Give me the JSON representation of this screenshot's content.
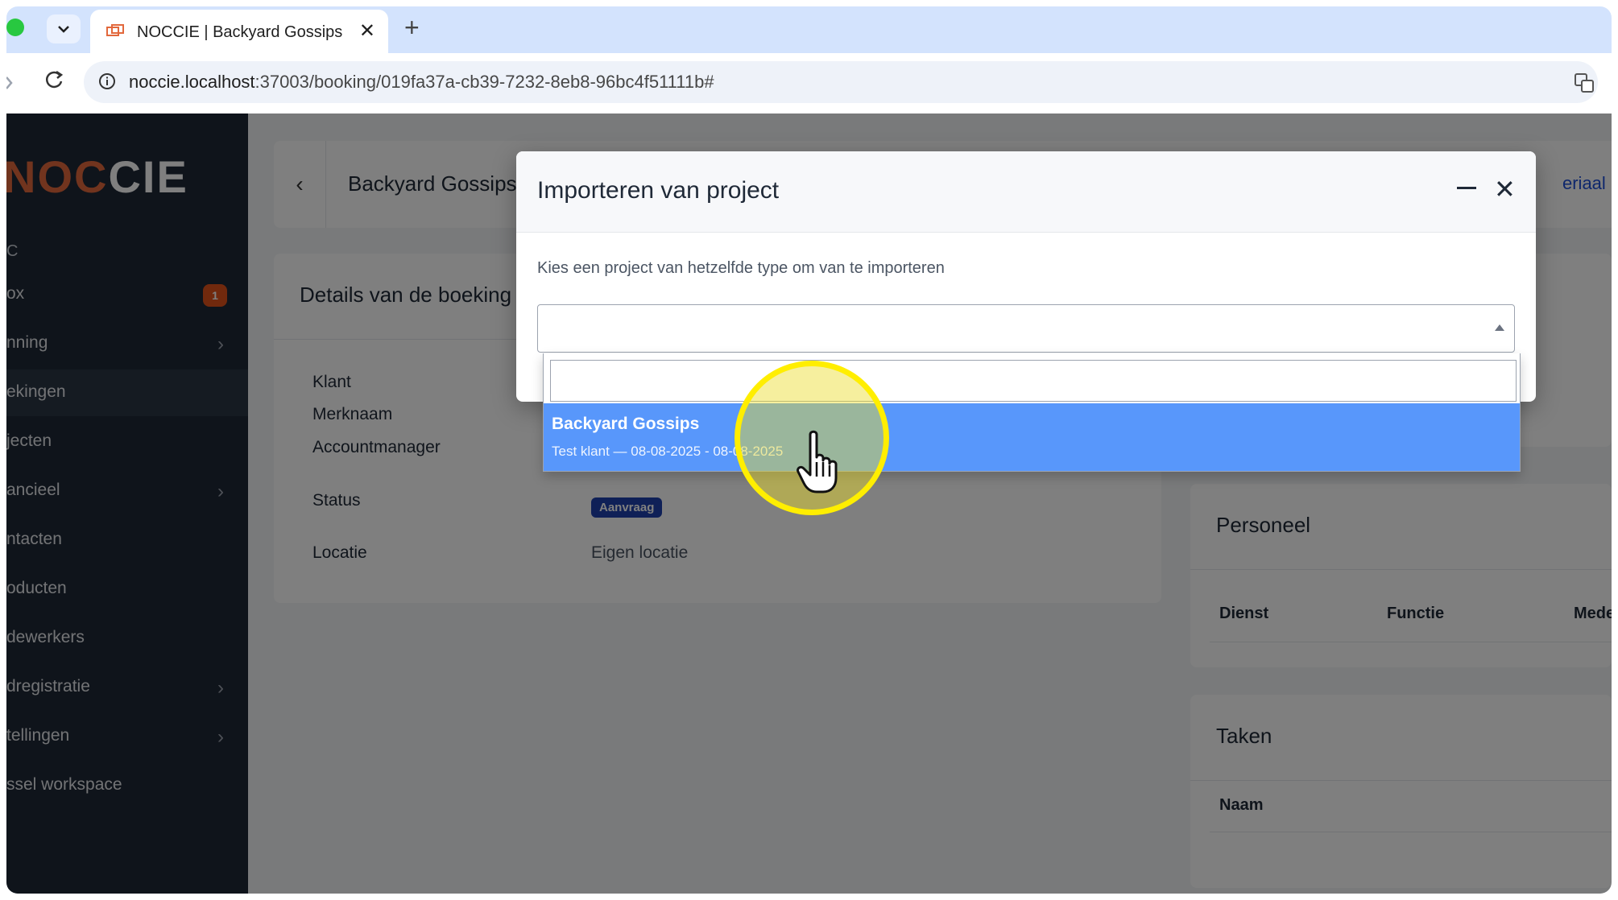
{
  "browser": {
    "tab_title": "NOCCIE | Backyard Gossips",
    "close_glyph": "✕",
    "new_tab_glyph": "+",
    "url_host": "noccie.localhost",
    "url_rest": ":37003/booking/019fa37a-cb39-7232-8eb8-96bc4f51111b#"
  },
  "sidebar": {
    "logo_noc": "NOC",
    "logo_cie": "CIE",
    "section": "C",
    "items": [
      {
        "label": "ox",
        "badge": "1"
      },
      {
        "label": "nning",
        "chevron": "›"
      },
      {
        "label": "ekingen"
      },
      {
        "label": "jecten"
      },
      {
        "label": "ancieel",
        "chevron": "›"
      },
      {
        "label": "ntacten"
      },
      {
        "label": "oducten"
      },
      {
        "label": "dewerkers"
      },
      {
        "label": "dregistratie",
        "chevron": "›"
      },
      {
        "label": "tellingen",
        "chevron": "›"
      },
      {
        "label": "ssel workspace"
      }
    ]
  },
  "header": {
    "back_glyph": "‹",
    "title": "Backyard Gossips",
    "link": "eriaal"
  },
  "details": {
    "title": "Details van de boeking",
    "labels": {
      "klant": "Klant",
      "merknaam": "Merknaam",
      "accountmanager": "Accountmanager",
      "status": "Status",
      "locatie": "Locatie"
    },
    "status_value": "Aanvraag",
    "locatie_value": "Eigen locatie"
  },
  "personeel": {
    "title": "Personeel",
    "columns": [
      "Dienst",
      "Functie",
      "Mede"
    ]
  },
  "taken": {
    "title": "Taken",
    "columns": [
      "Naam"
    ]
  },
  "modal": {
    "title": "Importeren van project",
    "minimize_label": "—",
    "close_glyph": "✕",
    "hint": "Kies een project van hetzelfde type om van te importeren",
    "select_value": "",
    "search_value": "",
    "option_title": "Backyard Gossips",
    "option_subtitle": "Test klant — 08-08-2025 - 08-08-2025"
  },
  "colors": {
    "brand": "#e2683c",
    "sidebar_bg": "#1f2937",
    "option_highlight": "#5897fb",
    "status_badge": "#1e40af",
    "cursor_highlight": "#ffee00"
  }
}
